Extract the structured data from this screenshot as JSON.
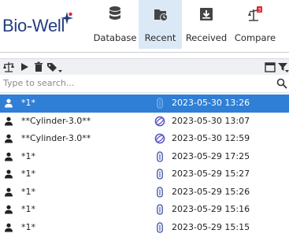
{
  "app": {
    "logo_text": "Bio-Well"
  },
  "colors": {
    "brand": "#243c82",
    "accent_selected": "#2f7fd6",
    "active_tab_bg": "#dbe8f6",
    "badge_red": "#e0262b",
    "orbit_purple": "#5b54c9",
    "finger_blue": "#3d4fa8"
  },
  "toolbar_main": {
    "items": [
      {
        "label": "Database",
        "icon": "database-icon"
      },
      {
        "label": "Recent",
        "icon": "folder-clock-icon",
        "active": true
      },
      {
        "label": "Received",
        "icon": "inbox-download-icon"
      },
      {
        "label": "Compare",
        "icon": "compare-scale-icon"
      }
    ]
  },
  "filter_bar": {
    "icons": [
      "scale-icon",
      "play-icon",
      "trash-icon",
      "tag-icon",
      "calendar-icon",
      "filter-icon"
    ]
  },
  "search": {
    "placeholder": "Type to search..."
  },
  "records": [
    {
      "name": "*1*",
      "type": "finger-icon",
      "date": "2023-05-30 13:26",
      "selected": true
    },
    {
      "name": "**Cylinder-3.0**",
      "type": "orbit-icon",
      "date": "2023-05-30 13:07"
    },
    {
      "name": "**Cylinder-3.0**",
      "type": "orbit-icon",
      "date": "2023-05-30 12:59"
    },
    {
      "name": "*1*",
      "type": "finger-icon",
      "date": "2023-05-29 17:25"
    },
    {
      "name": "*1*",
      "type": "finger-icon",
      "date": "2023-05-29 15:27"
    },
    {
      "name": "*1*",
      "type": "finger-icon",
      "date": "2023-05-29 15:26"
    },
    {
      "name": "*1*",
      "type": "finger-icon",
      "date": "2023-05-29 15:16"
    },
    {
      "name": "*1*",
      "type": "finger-icon",
      "date": "2023-05-29 15:15"
    }
  ]
}
